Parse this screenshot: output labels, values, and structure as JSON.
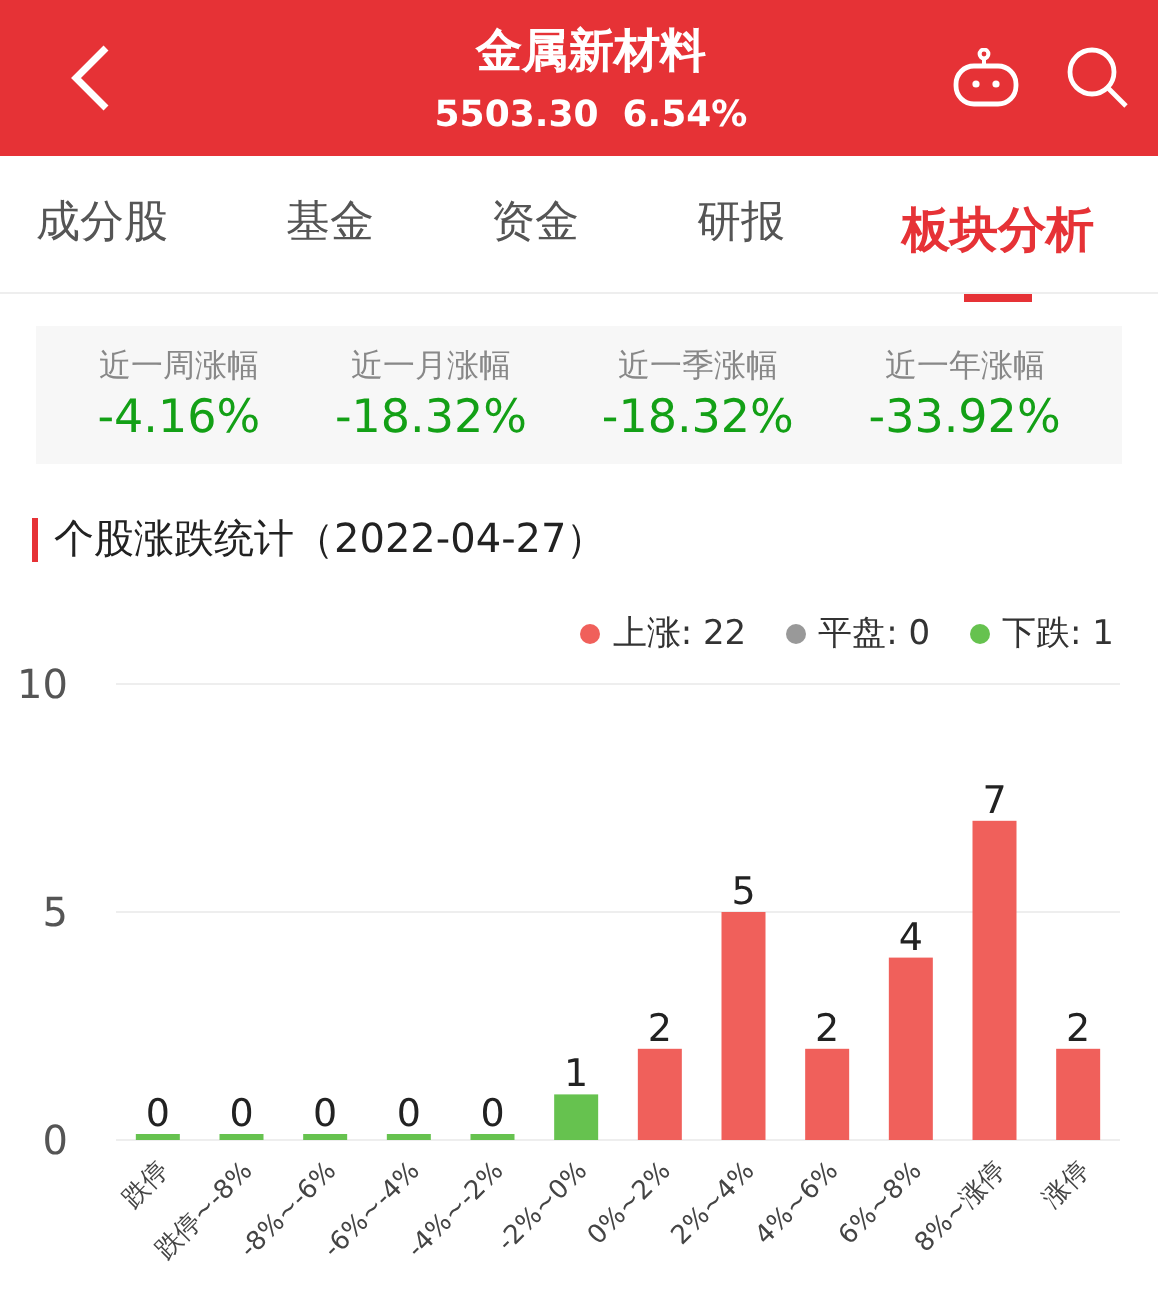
{
  "header": {
    "title": "金属新材料",
    "price": "5503.30",
    "change": "6.54%"
  },
  "tabs": [
    {
      "label": "成分股",
      "selected": false
    },
    {
      "label": "基金",
      "selected": false
    },
    {
      "label": "资金",
      "selected": false
    },
    {
      "label": "研报",
      "selected": false
    },
    {
      "label": "板块分析",
      "selected": true
    }
  ],
  "stats": [
    {
      "label": "近一周涨幅",
      "value": "-4.16%"
    },
    {
      "label": "近一月涨幅",
      "value": "-18.32%"
    },
    {
      "label": "近一季涨幅",
      "value": "-18.32%"
    },
    {
      "label": "近一年涨幅",
      "value": "-33.92%"
    }
  ],
  "section_title": "个股涨跌统计（2022-04-27）",
  "legend": [
    {
      "label": "上涨: 22",
      "color": "#f0605b"
    },
    {
      "label": "平盘: 0",
      "color": "#999999"
    },
    {
      "label": "下跌: 1",
      "color": "#66c24f"
    }
  ],
  "chart_data": {
    "type": "bar",
    "categories": [
      "跌停",
      "跌停~-8%",
      "-8%~-6%",
      "-6%~-4%",
      "-4%~-2%",
      "-2%~0%",
      "0%~2%",
      "2%~4%",
      "4%~6%",
      "6%~8%",
      "8%~涨停",
      "涨停"
    ],
    "series": [
      {
        "color": "#66c24f",
        "values": [
          0,
          0,
          0,
          0,
          0,
          1,
          null,
          null,
          null,
          null,
          null,
          null
        ]
      },
      {
        "color": "#f0605b",
        "values": [
          null,
          null,
          null,
          null,
          null,
          null,
          2,
          5,
          2,
          4,
          7,
          2
        ]
      }
    ],
    "ylim": [
      0,
      10
    ],
    "yticks": [
      0,
      5,
      10
    ],
    "data_labels": true
  }
}
